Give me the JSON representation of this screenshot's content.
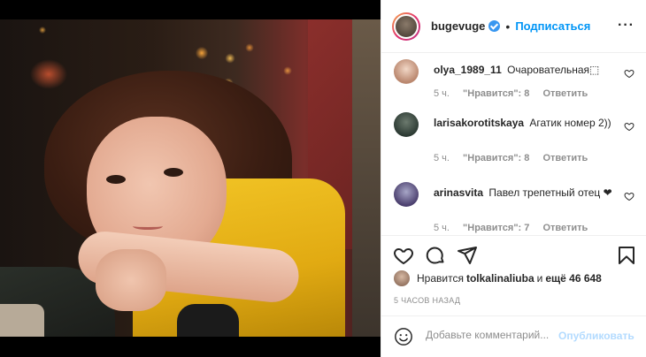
{
  "post": {
    "username": "bugevuge",
    "follow_label": "Подписаться",
    "more_label": "···"
  },
  "comments": [
    {
      "user": "olya_1989_11",
      "text": "Очаровательная⬚",
      "time": "5 ч.",
      "likes": "\"Нравится\": 8",
      "reply": "Ответить"
    },
    {
      "user": "larisakorotitskaya",
      "text": "Агатик номер 2))",
      "time": "5 ч.",
      "likes": "\"Нравится\": 8",
      "reply": "Ответить"
    },
    {
      "user": "arinasvita",
      "text": "Павел трепетный отец ❤",
      "time": "5 ч.",
      "likes": "\"Нравится\": 7",
      "reply": "Ответить"
    }
  ],
  "likes": {
    "prefix": "Нравится",
    "user": "tolkalinaliuba",
    "middle": "и",
    "others": "ещё 46 648"
  },
  "time_ago": "5 ЧАСОВ НАЗАД",
  "add_comment": {
    "placeholder": "Добавьте комментарий...",
    "publish_label": "Опубликовать"
  },
  "icons": [
    "heart-icon",
    "comment-icon",
    "share-icon",
    "bookmark-icon",
    "verified-icon",
    "emoji-icon"
  ],
  "colors": {
    "accent": "#0095f6",
    "verified": "#3897f0",
    "muted": "#8e8e8e",
    "publish_disabled": "#b3dbff"
  }
}
